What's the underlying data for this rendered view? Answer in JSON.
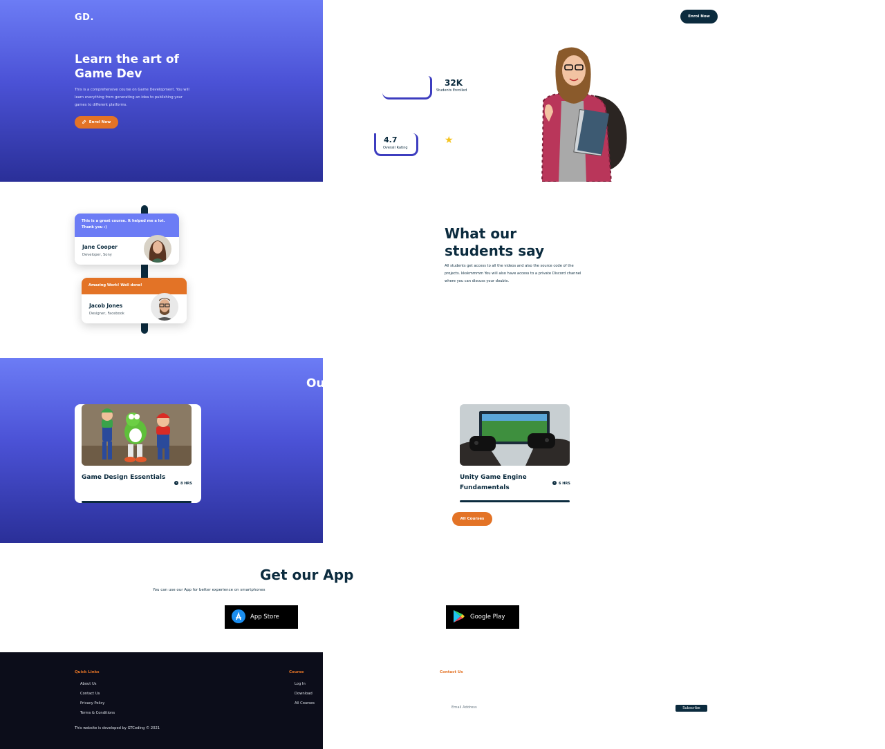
{
  "brand": {
    "logo": "GD."
  },
  "nav": {
    "cta_label": "Enrol Now"
  },
  "hero": {
    "title": "Learn the art of Game Dev",
    "subtitle": "This is a comprehensive course on Game Development. You will learn everything from generating an idea to publishing your games to different platforms.",
    "cta_label": "Enrol Now",
    "stats": [
      {
        "value": "32K",
        "label": "Students Enrolled"
      },
      {
        "value": "4.7",
        "label": "Overall Rating"
      }
    ]
  },
  "testimonials": {
    "title": "What our students say",
    "description": "All students get access to all the videos and also the source code of the projects. kkskmmmm You will also have access to a private Discord channel where you can discuss your doubts.",
    "items": [
      {
        "quote": "This is a great course. It helped me a lot. Thank you :)",
        "name": "Jane Cooper",
        "role": "Developer, Sony"
      },
      {
        "quote": "Amazing Work! Well done!",
        "name": "Jacob Jones",
        "role": "Designer, Facebook"
      }
    ]
  },
  "courses": {
    "title_visible": "Ou",
    "items": [
      {
        "title": "Game Design Essentials",
        "duration": "8 HRS"
      },
      {
        "title": "Unity Game Engine Fundamentals",
        "duration": "6 HRS"
      }
    ],
    "all_label": "All Courses"
  },
  "app": {
    "title": "Get our App",
    "subtitle": "You can use our App for better experience on smartphones",
    "appstore_label": "App Store",
    "googleplay_label": "Google Play"
  },
  "footer": {
    "quick_links_title": "Quick Links",
    "quick_links": [
      "About Us",
      "Contact Us",
      "Privacy Policy",
      "Terms & Conditions"
    ],
    "course_title": "Course",
    "course_links": [
      "Log In",
      "Download",
      "All Courses"
    ],
    "contact_title": "Contact Us",
    "email_placeholder": "Email Address",
    "subscribe_label": "Subscribe",
    "copyright": "This website is developed by GTCoding © 2021"
  },
  "colors": {
    "primary": "#6c7cf5",
    "accent": "#e37326",
    "navy": "#0b2b3e",
    "star": "#f5c31d"
  }
}
